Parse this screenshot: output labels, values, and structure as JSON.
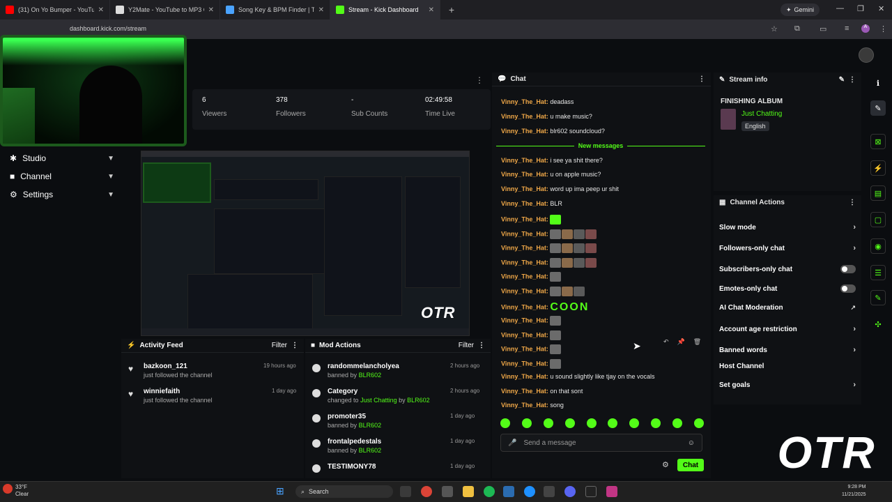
{
  "browser": {
    "tabs": [
      {
        "title": "(31) On Yo Bumper - YouTube",
        "color": "#ff0000",
        "active": false
      },
      {
        "title": "Y2Mate - YouTube to MP3 Conv",
        "color": "#dddddd",
        "active": false
      },
      {
        "title": "Song Key & BPM Finder | Tunel",
        "color": "#4aa3ff",
        "active": false
      },
      {
        "title": "Stream - Kick Dashboard",
        "color": "#53fc18",
        "active": true
      }
    ],
    "new_tab": "+",
    "gemini_label": "Gemini",
    "url": "dashboard.kick.com/stream"
  },
  "nav": {
    "items": [
      {
        "label": "Studio"
      },
      {
        "label": "Channel"
      },
      {
        "label": "Settings"
      }
    ]
  },
  "stats": [
    {
      "value": "6",
      "label": "Viewers"
    },
    {
      "value": "378",
      "label": "Followers"
    },
    {
      "value": "-",
      "label": "Sub Counts"
    },
    {
      "value": "02:49:58",
      "label": "Time Live"
    }
  ],
  "overlay_logo": "OTR",
  "activity_feed": {
    "title": "Activity Feed",
    "filter": "Filter",
    "items": [
      {
        "name": "bazkoon_121",
        "sub": "just followed the channel",
        "time": "19 hours ago"
      },
      {
        "name": "winniefaith",
        "sub": "just followed the channel",
        "time": "1 day ago"
      }
    ]
  },
  "mod_actions": {
    "title": "Mod Actions",
    "filter": "Filter",
    "items": [
      {
        "name": "randommelancholyea",
        "pre": "banned by",
        "hl": "BLR602",
        "time": "2 hours ago"
      },
      {
        "name": "Category",
        "pre": "changed to",
        "hl": "Just Chatting",
        "by": "by",
        "hl2": "BLR602",
        "time": "2 hours ago"
      },
      {
        "name": "promoter35",
        "pre": "banned by",
        "hl": "BLR602",
        "time": "1 day ago"
      },
      {
        "name": "frontalpedestals",
        "pre": "banned by",
        "hl": "BLR602",
        "time": "1 day ago"
      },
      {
        "name": "TESTIMONY78",
        "pre": "",
        "hl": "",
        "time": "1 day ago"
      }
    ]
  },
  "chat": {
    "title": "Chat",
    "new_messages": "New messages",
    "messages": [
      {
        "user": "Vinny_The_Hat:",
        "text": "deadass"
      },
      {
        "user": "Vinny_The_Hat:",
        "text": "u make music?"
      },
      {
        "user": "Vinny_The_Hat:",
        "text": "blr602 soundcloud?"
      },
      {
        "user": "Vinny_The_Hat:",
        "text": "i see ya shit there?"
      },
      {
        "user": "Vinny_The_Hat:",
        "text": "u on apple music?"
      },
      {
        "user": "Vinny_The_Hat:",
        "text": "word up ima peep ur shit"
      },
      {
        "user": "Vinny_The_Hat:",
        "text": "BLR"
      },
      {
        "user": "Vinny_The_Hat:",
        "text": "",
        "emotes": 1
      },
      {
        "user": "Vinny_The_Hat:",
        "text": "",
        "emotes": 4
      },
      {
        "user": "Vinny_The_Hat:",
        "text": "",
        "emotes": 4
      },
      {
        "user": "Vinny_The_Hat:",
        "text": "",
        "emotes": 4
      },
      {
        "user": "Vinny_The_Hat:",
        "text": "",
        "emotes": 1
      },
      {
        "user": "Vinny_The_Hat:",
        "text": "",
        "emotes": 3
      },
      {
        "user": "Vinny_The_Hat:",
        "text": "COON",
        "emotes": 0
      },
      {
        "user": "Vinny_The_Hat:",
        "text": "",
        "emotes": 1
      },
      {
        "user": "Vinny_The_Hat:",
        "text": "",
        "emotes": 1
      },
      {
        "user": "Vinny_The_Hat:",
        "text": "",
        "emotes": 1
      },
      {
        "user": "Vinny_The_Hat:",
        "text": "",
        "emotes": 1
      },
      {
        "user": "Vinny_The_Hat:",
        "text": "u sound slightly like tjay on the vocals"
      },
      {
        "user": "Vinny_The_Hat:",
        "text": "on that sont"
      },
      {
        "user": "Vinny_The_Hat:",
        "text": "song"
      }
    ],
    "placeholder": "Send a message",
    "send": "Chat"
  },
  "stream_info": {
    "title": "Stream info",
    "stream_title": "FINISHING ALBUM",
    "category": "Just Chatting",
    "language": "English"
  },
  "channel_actions": {
    "title": "Channel Actions",
    "items": [
      {
        "label": "Slow mode",
        "control": "arrow"
      },
      {
        "label": "Followers-only chat",
        "control": "arrow"
      },
      {
        "label": "Subscribers-only chat",
        "control": "toggle"
      },
      {
        "label": "Emotes-only chat",
        "control": "toggle"
      },
      {
        "label": "AI Chat Moderation",
        "control": "external"
      },
      {
        "label": "Account age restriction",
        "control": "arrow"
      },
      {
        "label": "Banned words",
        "control": "arrow"
      },
      {
        "label": "Host Channel",
        "control": "none"
      },
      {
        "label": "Set goals",
        "control": "arrow"
      }
    ]
  },
  "taskbar": {
    "weather_temp": "33°F",
    "weather_desc": "Clear",
    "search": "Search",
    "time": "9:28 PM",
    "date": "11/21/2025"
  },
  "colors": {
    "accent": "#53fc18",
    "username": "#f0a848"
  }
}
